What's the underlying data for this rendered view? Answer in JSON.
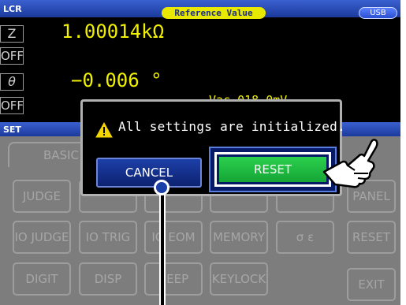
{
  "header": {
    "mode_label": "LCR",
    "reference_badge": "Reference Value",
    "usb_badge": "USB"
  },
  "measurements": [
    {
      "param": "Z",
      "value": "1.00014kΩ"
    },
    {
      "param": "θ",
      "value": "−0.006 °"
    }
  ],
  "off_label": "OFF",
  "vac_text": "Vac   018.0mV",
  "set_bar": {
    "label": "SET"
  },
  "tabs": {
    "basic": "BASIC"
  },
  "background_buttons": {
    "judge": "JUDGE",
    "panel": "PANEL",
    "io_judge": "IO JUDGE",
    "io_trig": "IO TRIG",
    "io_eom": "IO EOM",
    "memory": "MEMORY",
    "sigma": "σ ε",
    "reset": "RESET",
    "digit": "DIGIT",
    "disp": "DISP",
    "beep": "BEEP",
    "keylock": "KEYLOCK",
    "exit": "EXIT"
  },
  "dialog": {
    "message": "All settings are initialized.",
    "cancel_label": "CANCEL",
    "reset_label": "RESET"
  },
  "colors": {
    "accent_blue": "#1b3a9c",
    "value_yellow": "#f0f000",
    "reset_green": "#15a535",
    "warning_yellow": "#f2d400"
  },
  "icons": [
    "warning-icon",
    "pointing-hand-icon"
  ]
}
